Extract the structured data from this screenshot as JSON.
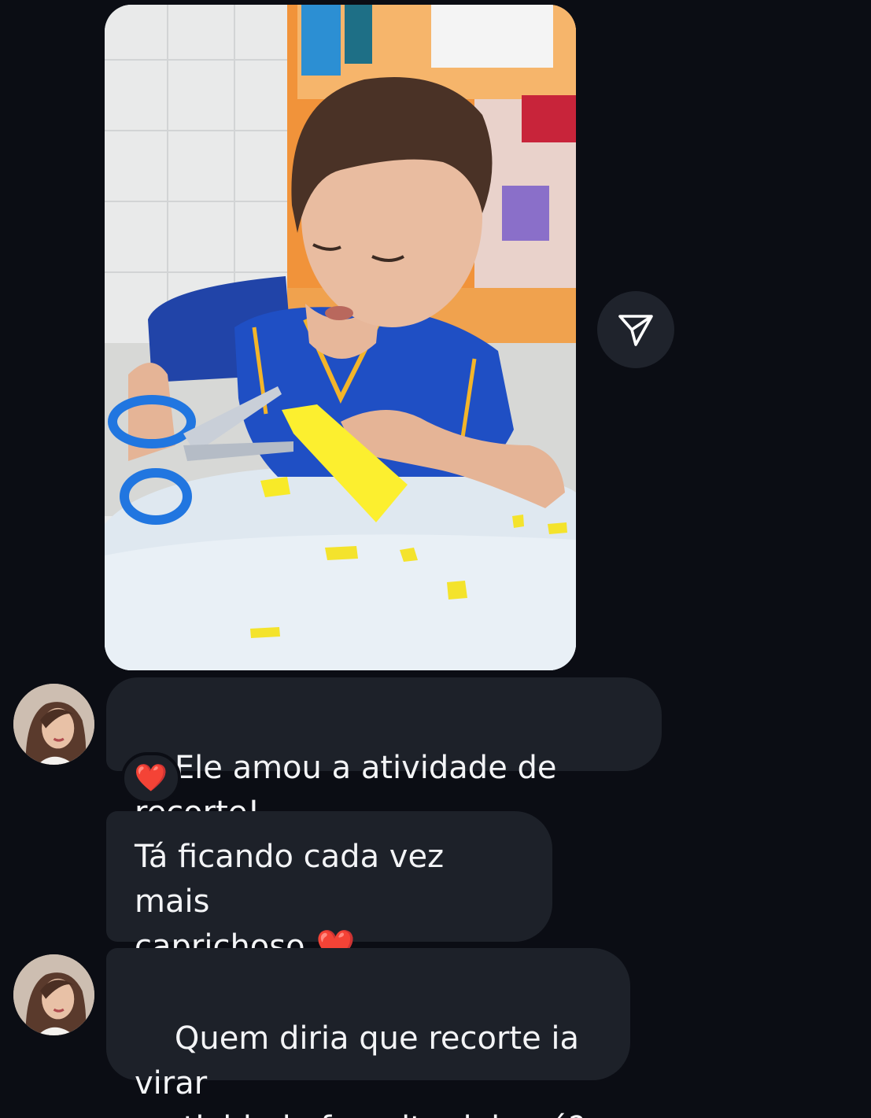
{
  "thread": {
    "photo_message": {
      "image": "child-cutting-yellow-paper-photo",
      "share_icon": "paper-plane-icon"
    },
    "messages": [
      {
        "text": "Ele amou a atividade de recorte!",
        "reaction": "❤️",
        "avatar": "sender-avatar-photo"
      },
      {
        "text": "Tá ficando cada vez mais\ncaprichoso",
        "emoji": "❤️"
      },
      {
        "text": "Quem diria que recorte ia virar\na atividade favorita dele né?",
        "avatar": "sender-avatar-photo"
      }
    ]
  },
  "colors": {
    "background": "#0b0d14",
    "bubble": "#1d2129",
    "text": "#f3f4f6",
    "heart": "#e01b24"
  }
}
